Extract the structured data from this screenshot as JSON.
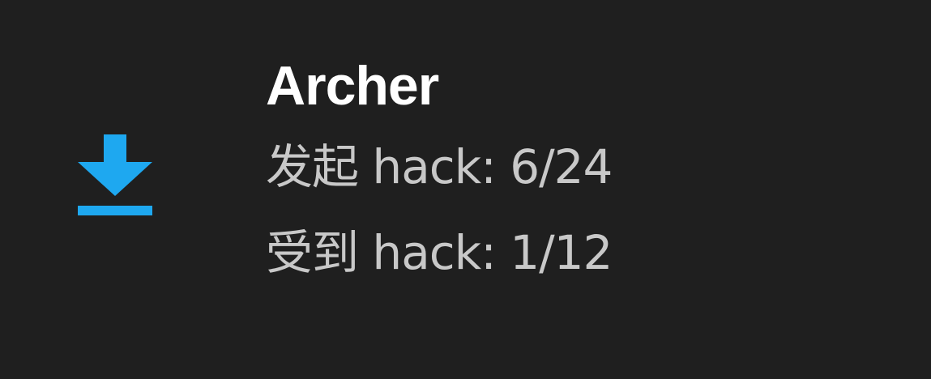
{
  "item": {
    "icon": "download-icon",
    "icon_color": "#1ea8f0",
    "name": "Archer",
    "hacks_initiated": "发起 hack: 6/24",
    "hacks_received": "受到 hack: 1/12"
  },
  "colors": {
    "background": "#1f1f1f",
    "name_text": "#ffffff",
    "stat_text": "#c8c8c8"
  }
}
